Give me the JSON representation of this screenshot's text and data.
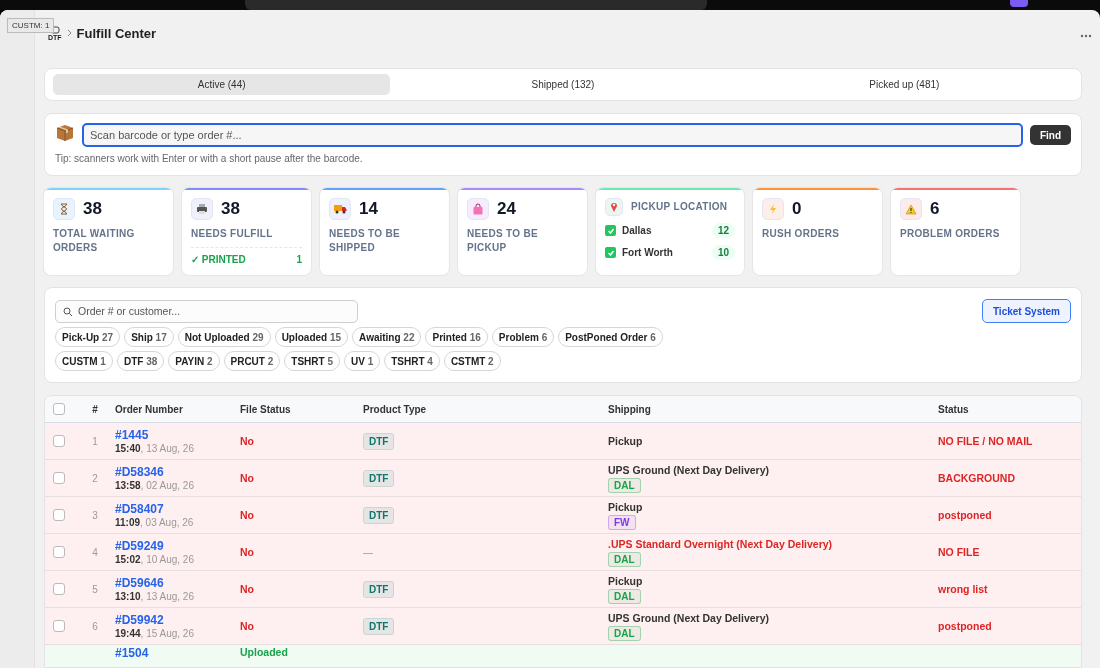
{
  "tooltip": "CUSTM: 1",
  "breadcrumb": {
    "logo": "DTF",
    "title": "Fulfill Center"
  },
  "tabs": [
    {
      "label": "Active (44)",
      "selected": true
    },
    {
      "label": "Shipped (132)",
      "selected": false
    },
    {
      "label": "Picked up (481)",
      "selected": false
    }
  ],
  "scan": {
    "placeholder": "Scan barcode or type order #...",
    "button": "Find",
    "tip": "Tip: scanners work with Enter or with a short pause after the barcode."
  },
  "stats": [
    {
      "kind": "count",
      "value": "38",
      "label": "TOTAL WAITING ORDERS",
      "color": "#7dd3fc"
    },
    {
      "kind": "count",
      "value": "38",
      "label": "NEEDS FULFILL",
      "color": "#818cf8",
      "sub": {
        "label": "✓ PRINTED",
        "value": "1"
      }
    },
    {
      "kind": "count",
      "value": "14",
      "label": "NEEDS TO BE SHIPPED",
      "color": "#60a5fa"
    },
    {
      "kind": "count",
      "value": "24",
      "label": "NEEDS TO BE PICKUP",
      "color": "#a78bfa"
    },
    {
      "kind": "locations",
      "label": "PICKUP LOCATION",
      "color": "#6ee7b7",
      "items": [
        {
          "name": "Dallas",
          "count": "12",
          "checked": true
        },
        {
          "name": "Fort Worth",
          "count": "10",
          "checked": true
        }
      ]
    },
    {
      "kind": "count",
      "value": "0",
      "label": "RUSH ORDERS",
      "color": "#fb923c"
    },
    {
      "kind": "count",
      "value": "6",
      "label": "PROBLEM ORDERS",
      "color": "#f87171"
    }
  ],
  "filters": {
    "placeholder": "Order # or customer...",
    "button": "Ticket System",
    "chip_rows": [
      [
        {
          "label": "Pick-Up",
          "count": "27"
        },
        {
          "label": "Ship",
          "count": "17"
        },
        {
          "label": "Not Uploaded",
          "count": "29"
        },
        {
          "label": "Uploaded",
          "count": "15"
        },
        {
          "label": "Awaiting",
          "count": "22"
        },
        {
          "label": "Printed",
          "count": "16"
        },
        {
          "label": "Problem",
          "count": "6"
        },
        {
          "label": "PostPoned Order",
          "count": "6"
        }
      ],
      [
        {
          "label": "CUSTM",
          "count": "1"
        },
        {
          "label": "DTF",
          "count": "38"
        },
        {
          "label": "PAYIN",
          "count": "2"
        },
        {
          "label": "PRCUT",
          "count": "2"
        },
        {
          "label": "TSHRT",
          "count": "5"
        },
        {
          "label": "UV",
          "count": "1"
        },
        {
          "label": "TSHRT",
          "count": "4"
        },
        {
          "label": "CSTMT",
          "count": "2"
        }
      ]
    ]
  },
  "table": {
    "checked": false,
    "columns": [
      "#",
      "Order Number",
      "File Status",
      "Product Type",
      "Shipping",
      "Status"
    ],
    "rows": [
      {
        "kind": "problem",
        "checked": false,
        "index": "1",
        "order": "#1445",
        "time": "15:40",
        "date": ", 13 Aug, 26",
        "file_status": "No",
        "product": "DTF",
        "shipping": "Pickup",
        "shipping_alert": false,
        "status": "NO FILE / NO MAIL"
      },
      {
        "kind": "problem",
        "checked": false,
        "index": "2",
        "order": "#D58346",
        "time": "13:58",
        "date": ", 02 Aug, 26",
        "file_status": "No",
        "product": "DTF",
        "shipping": "UPS Ground (Next Day Delivery)",
        "shipping_alert": false,
        "location": {
          "label": "DAL",
          "color": "#16a34a"
        },
        "status": "BACKGROUND"
      },
      {
        "kind": "problem",
        "checked": false,
        "index": "3",
        "order": "#D58407",
        "time": "11:09",
        "date": ", 03 Aug, 26",
        "file_status": "No",
        "product": "DTF",
        "shipping": "Pickup",
        "shipping_alert": false,
        "location": {
          "label": "FW",
          "color": "#7c3aed"
        },
        "status": "postponed"
      },
      {
        "kind": "problem",
        "checked": false,
        "index": "4",
        "order": "#D59249",
        "time": "15:02",
        "date": ", 10 Aug, 26",
        "file_status": "No",
        "product_missing": "—",
        "shipping": ".UPS Standard Overnight (Next Day Delivery)",
        "shipping_alert": true,
        "location": {
          "label": "DAL",
          "color": "#16a34a"
        },
        "status": "NO FILE"
      },
      {
        "kind": "problem",
        "checked": false,
        "index": "5",
        "order": "#D59646",
        "time": "13:10",
        "date": ", 13 Aug, 26",
        "file_status": "No",
        "product": "DTF",
        "shipping": "Pickup",
        "shipping_alert": false,
        "location": {
          "label": "DAL",
          "color": "#16a34a"
        },
        "status": "wrong list"
      },
      {
        "kind": "problem",
        "checked": false,
        "index": "6",
        "order": "#D59942",
        "time": "19:44",
        "date": ", 15 Aug, 26",
        "file_status": "No",
        "product": "DTF",
        "shipping": "UPS Ground (Next Day Delivery)",
        "shipping_alert": false,
        "location": {
          "label": "DAL",
          "color": "#16a34a"
        },
        "status": "postponed"
      },
      {
        "kind": "ok",
        "order": "#1504",
        "file_status": "Uploaded"
      }
    ]
  }
}
